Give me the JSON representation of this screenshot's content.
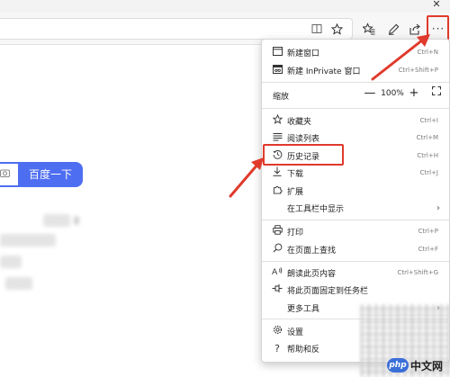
{
  "window": {
    "close_glyph": "✕"
  },
  "toolbar": {
    "icons": [
      "reader-view-icon",
      "favorite-star-icon",
      "favorites-bar-icon",
      "pen-icon",
      "share-icon",
      "more-menu-icon"
    ],
    "more_glyph": "···"
  },
  "page": {
    "search_button_label": "百度一下"
  },
  "menu": {
    "new_window": {
      "label": "新建窗口",
      "shortcut": "Ctrl+N"
    },
    "new_inprivate": {
      "label": "新建 InPrivate 窗口",
      "shortcut": "Ctrl+Shift+P"
    },
    "zoom": {
      "label": "缩放",
      "minus": "—",
      "value": "100%",
      "plus": "+"
    },
    "favorites": {
      "label": "收藏夹",
      "shortcut": "Ctrl+I"
    },
    "reading_list": {
      "label": "阅读列表",
      "shortcut": "Ctrl+M"
    },
    "history": {
      "label": "历史记录",
      "shortcut": "Ctrl+H"
    },
    "downloads": {
      "label": "下载",
      "shortcut": "Ctrl+J"
    },
    "extensions": {
      "label": "扩展"
    },
    "show_in_toolbar": {
      "label": "在工具栏中显示"
    },
    "print": {
      "label": "打印",
      "shortcut": "Ctrl+P"
    },
    "find_on_page": {
      "label": "在页面上查找",
      "shortcut": "Ctrl+F"
    },
    "read_aloud": {
      "label": "朗读此页内容",
      "shortcut": "Ctrl+Shift+G"
    },
    "pin_taskbar": {
      "label": "将此页面固定到任务栏"
    },
    "more_tools": {
      "label": "更多工具"
    },
    "settings": {
      "label": "设置"
    },
    "help": {
      "label": "帮助和反"
    }
  },
  "colors": {
    "highlight": "#e03a2c",
    "baidu_blue": "#4e6ef2"
  },
  "watermark": {
    "badge": "php",
    "text": "中文网"
  }
}
